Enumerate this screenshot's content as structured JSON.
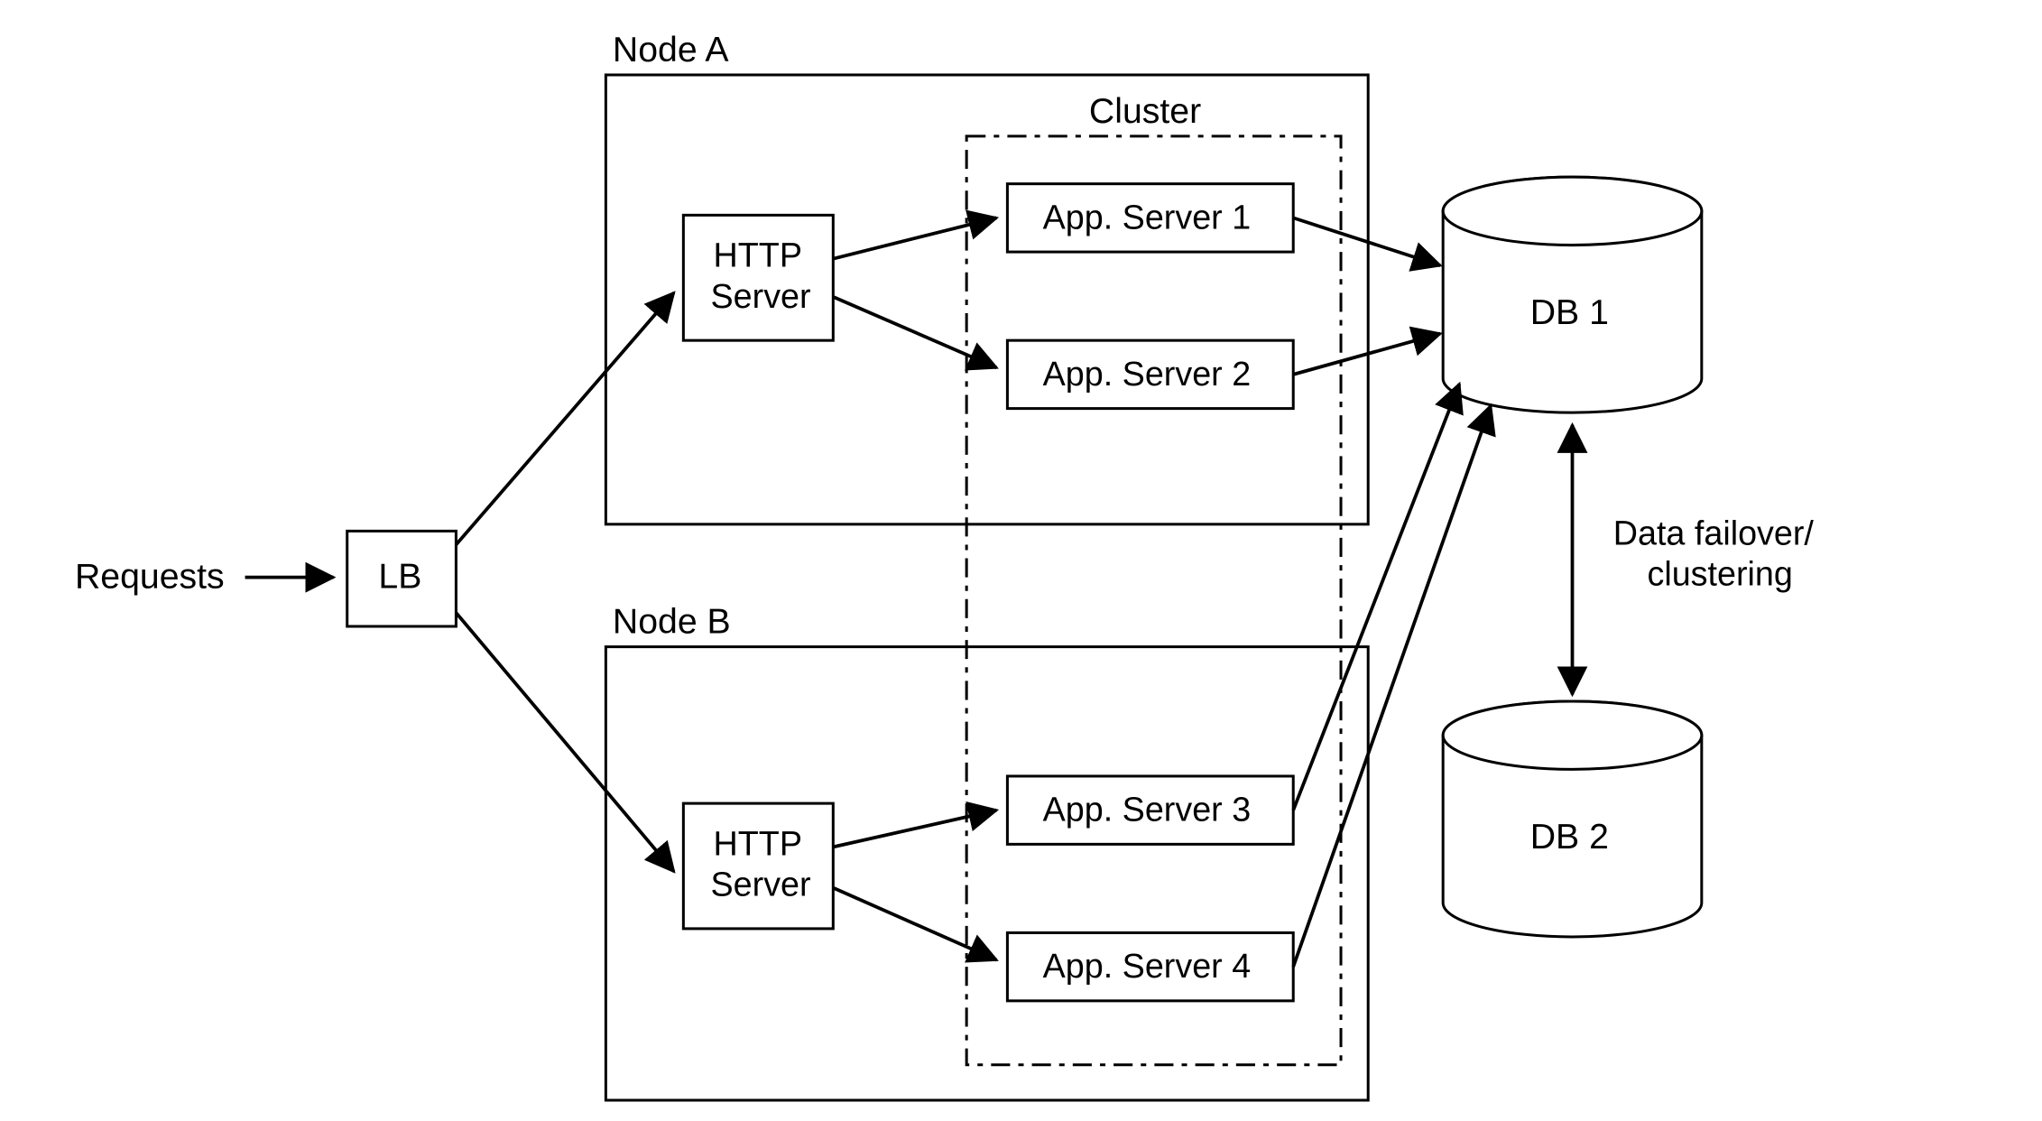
{
  "requests_label": "Requests",
  "lb_label": "LB",
  "nodeA_title": "Node A",
  "nodeB_title": "Node B",
  "cluster_title": "Cluster",
  "http_server_line1": "HTTP",
  "http_server_line2": "Server",
  "app_server_1": "App. Server 1",
  "app_server_2": "App. Server 2",
  "app_server_3": "App. Server 3",
  "app_server_4": "App. Server 4",
  "db1_label": "DB 1",
  "db2_label": "DB 2",
  "failover_line1": "Data failover/",
  "failover_line2": "clustering"
}
